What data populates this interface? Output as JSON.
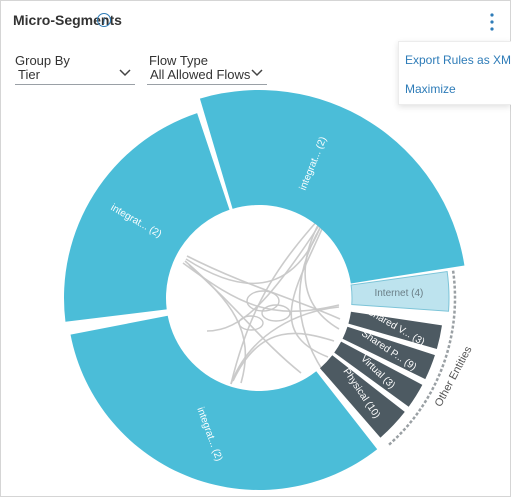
{
  "panel": {
    "title": "Micro-Segments",
    "info_icon": "info-icon",
    "more_icon": "more-vertical-icon"
  },
  "filters": {
    "group_by": {
      "label": "Group By",
      "value": "Tier"
    },
    "flow_type": {
      "label": "Flow Type",
      "value": "All Allowed Flows"
    }
  },
  "menu": {
    "items": [
      "Export Rules as XML",
      "Maximize"
    ]
  },
  "chart_data": {
    "type": "chord",
    "segments": [
      {
        "label": "integrat... (2)",
        "group": "tier",
        "color": "#4bbdd8"
      },
      {
        "label": "integrat... (2)",
        "group": "tier",
        "color": "#4bbdd8"
      },
      {
        "label": "integrat... (2)",
        "group": "tier",
        "color": "#4bbdd8"
      },
      {
        "label": "Internet (4)",
        "group": "other",
        "color": "#bde3ee"
      },
      {
        "label": "Shared V... (3)",
        "group": "other",
        "color": "#4d5a62"
      },
      {
        "label": "Shared P... (9)",
        "group": "other",
        "color": "#4d5a62"
      },
      {
        "label": "Virtual (3)",
        "group": "other",
        "color": "#4d5a62"
      },
      {
        "label": "Physical (10)",
        "group": "other",
        "color": "#4d5a62"
      }
    ],
    "group_label": "Other Entities",
    "colors": {
      "tier": "#4bbdd8",
      "internet": "#bde3ee",
      "entity": "#4d5a62",
      "link": "#c8c8c8"
    }
  }
}
